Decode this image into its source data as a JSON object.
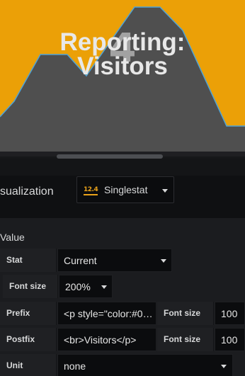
{
  "preview": {
    "stat_value": "4",
    "prefix_line1": "Reporting:",
    "prefix_line2": "Visitors",
    "background_color": "#eba007",
    "sparkline_fill": "#4f4f4f",
    "sparkline_line": "#4ea3d8"
  },
  "visualization": {
    "title": "sualization",
    "plugin_icon_text": "12.4",
    "plugin_name": "Singlestat"
  },
  "value_section": {
    "title": "Value",
    "stat_label": "Stat",
    "stat_value": "Current",
    "font_size_label": "Font size",
    "font_size_value": "200%",
    "prefix_label": "Prefix",
    "prefix_value": "<p style=\"color:#0…",
    "prefix_font_size_label": "Font size",
    "prefix_font_size_value": "100",
    "postfix_label": "Postfix",
    "postfix_value": "<br>Visitors</p>",
    "postfix_font_size_label": "Font size",
    "postfix_font_size_value": "100",
    "unit_label": "Unit",
    "unit_value": "none"
  }
}
